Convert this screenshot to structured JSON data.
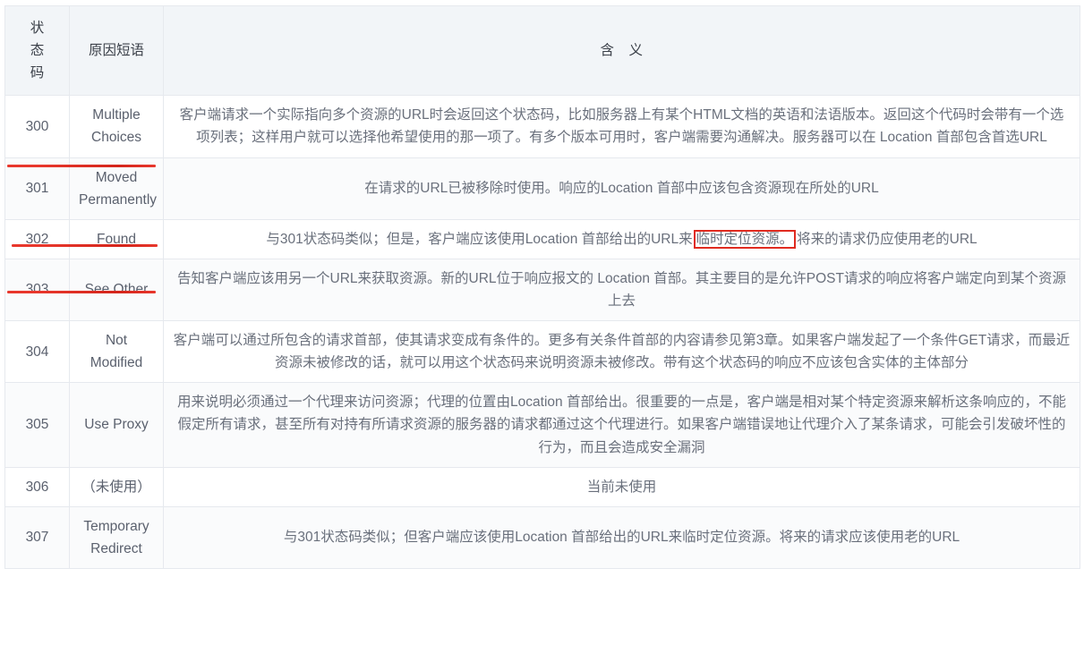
{
  "table": {
    "headers": {
      "code": "状态码",
      "code_chars": [
        "状",
        "态",
        "码"
      ],
      "reason": "原因短语",
      "meaning_left": "含",
      "meaning_right": "义"
    },
    "rows": [
      {
        "code": "300",
        "reason": "Multiple Choices",
        "reason_line1": "Multiple",
        "reason_line2": "Choices",
        "meaning": "客户端请求一个实际指向多个资源的URL时会返回这个状态码，比如服务器上有某个HTML文档的英语和法语版本。返回这个代码时会带有一个选项列表；这样用户就可以选择他希望使用的那一项了。有多个版本可用时，客户端需要沟通解决。服务器可以在 Location 首部包含首选URL",
        "highlighted": false,
        "underlined": true,
        "shaded": false
      },
      {
        "code": "301",
        "reason": "Moved Permanently",
        "reason_line1": "Moved",
        "reason_line2": "Permanently",
        "meaning": "在请求的URL已被移除时使用。响应的Location 首部中应该包含资源现在所处的URL",
        "highlighted": false,
        "underlined": true,
        "shaded": true
      },
      {
        "code": "302",
        "reason": "Found",
        "reason_line1": "Found",
        "reason_line2": "",
        "meaning_before": "与301状态码类似；但是，客户端应该使用Location 首部给出的URL来",
        "meaning_boxed": "临时定位资源。",
        "meaning_after": "将来的请求仍应使用老的URL",
        "meaning": "与301状态码类似；但是，客户端应该使用Location 首部给出的URL来临时定位资源。将来的请求仍应使用老的URL",
        "highlighted": true,
        "underlined": true,
        "shaded": false
      },
      {
        "code": "303",
        "reason": "See Other",
        "reason_line1": "See Other",
        "reason_line2": "",
        "meaning": "告知客户端应该用另一个URL来获取资源。新的URL位于响应报文的 Location 首部。其主要目的是允许POST请求的响应将客户端定向到某个资源上去",
        "highlighted": false,
        "underlined": false,
        "shaded": true
      },
      {
        "code": "304",
        "reason": "Not Modified",
        "reason_line1": "Not Modified",
        "reason_line2": "",
        "meaning": "客户端可以通过所包含的请求首部，使其请求变成有条件的。更多有关条件首部的内容请参见第3章。如果客户端发起了一个条件GET请求，而最近资源未被修改的话，就可以用这个状态码来说明资源未被修改。带有这个状态码的响应不应该包含实体的主体部分",
        "highlighted": false,
        "underlined": false,
        "shaded": false
      },
      {
        "code": "305",
        "reason": "Use Proxy",
        "reason_line1": "Use Proxy",
        "reason_line2": "",
        "meaning": "用来说明必须通过一个代理来访问资源；代理的位置由Location 首部给出。很重要的一点是，客户端是相对某个特定资源来解析这条响应的，不能假定所有请求，甚至所有对持有所请求资源的服务器的请求都通过这个代理进行。如果客户端错误地让代理介入了某条请求，可能会引发破坏性的行为，而且会造成安全漏洞",
        "highlighted": false,
        "underlined": false,
        "shaded": true
      },
      {
        "code": "306",
        "reason": "（未使用）",
        "reason_line1": "（未使用）",
        "reason_line2": "",
        "meaning": "当前未使用",
        "highlighted": false,
        "underlined": false,
        "shaded": false
      },
      {
        "code": "307",
        "reason": "Temporary Redirect",
        "reason_line1": "Temporary",
        "reason_line2": "Redirect",
        "meaning": "与301状态码类似；但客户端应该使用Location 首部给出的URL来临时定位资源。将来的请求应该使用老的URL",
        "highlighted": false,
        "underlined": false,
        "shaded": true
      }
    ]
  },
  "annotations": {
    "underline_color": "#e8372c",
    "box_color": "#e02b20",
    "underlined_codes": [
      "300",
      "301",
      "302"
    ],
    "boxed_text": "临时定位资源。"
  },
  "colors": {
    "header_background": "#f2f5f8",
    "border": "#e6e9ee",
    "row_alt_background": "#fafbfc",
    "text": "#6a707c",
    "accent_red": "#e8372c"
  }
}
